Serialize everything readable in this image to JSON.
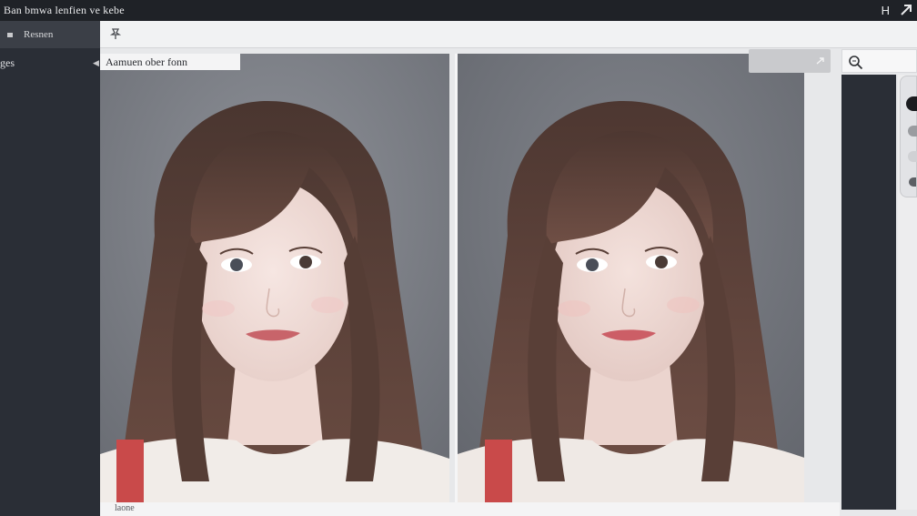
{
  "window": {
    "title": "Ban bmwa lenfien ve kebe",
    "corner_letter": "H"
  },
  "sidebar": {
    "header_label": "Resnen",
    "items": [
      {
        "label": "ges"
      }
    ]
  },
  "canvas": {
    "left_caption": "Aamuen ober fonn",
    "status_text": "laone"
  },
  "icons": {
    "toolbar": "pin-tool-icon",
    "search": "search-icon",
    "dropdown": "chevron-icon",
    "titlebar_right": "arrow-icon"
  },
  "colors": {
    "background_gray": "#7c7f86",
    "hair": "#5a4038",
    "sidebar": "#2a2e36"
  }
}
